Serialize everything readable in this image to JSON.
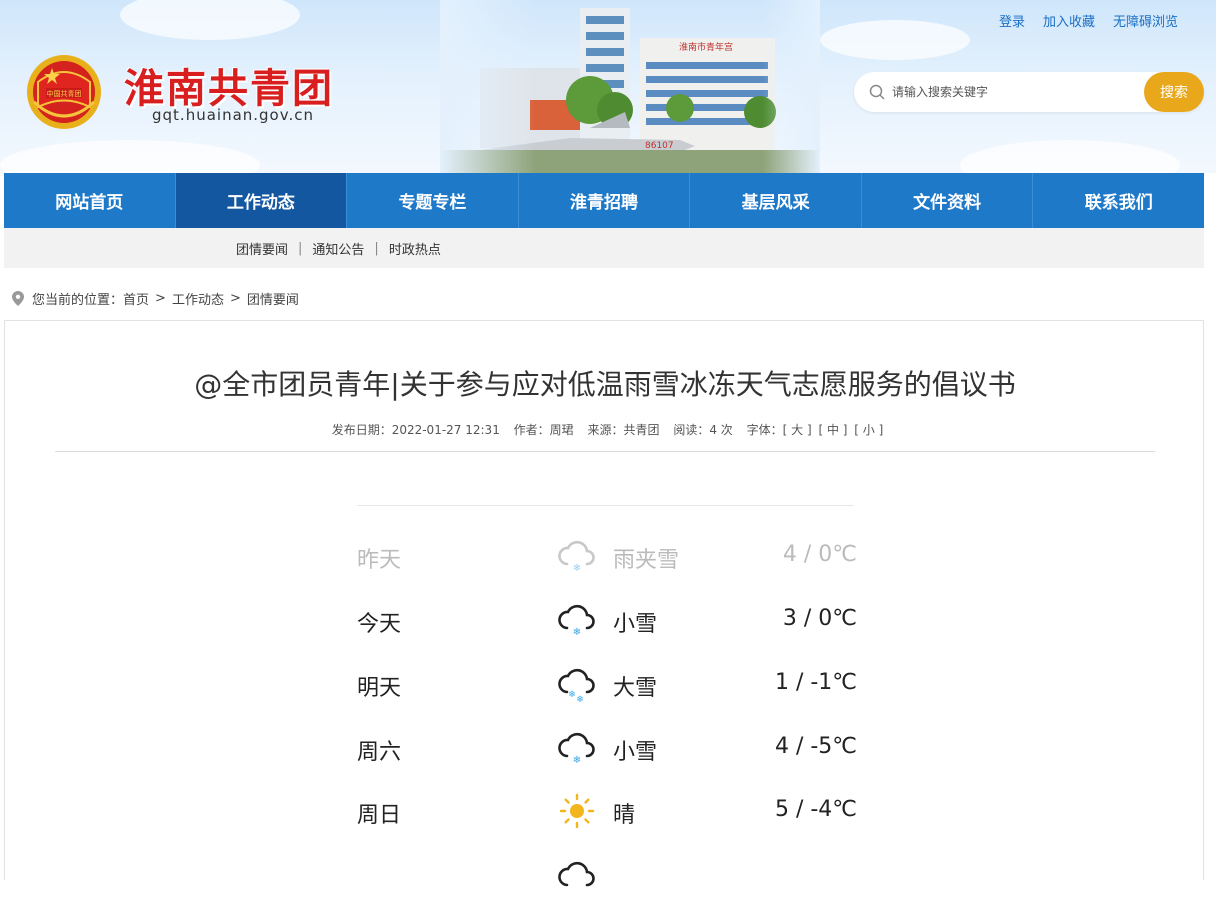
{
  "header": {
    "site_title": "淮南共青团",
    "site_domain": "gqt.huainan.gov.cn",
    "top_links": [
      "登录",
      "加入收藏",
      "无障碍浏览"
    ],
    "search_placeholder": "请输入搜索关键字",
    "search_button": "搜索",
    "building_sign": "淮南市青年宫",
    "plane_number": "86107"
  },
  "nav": {
    "items": [
      "网站首页",
      "工作动态",
      "专题专栏",
      "淮青招聘",
      "基层风采",
      "文件资料",
      "联系我们"
    ],
    "active": "工作动态"
  },
  "subnav": {
    "items": [
      "团情要闻",
      "通知公告",
      "时政热点"
    ],
    "separator": "|"
  },
  "breadcrumb": {
    "prefix": "您当前的位置：",
    "items": [
      "首页",
      "工作动态",
      "团情要闻"
    ],
    "separator": ">"
  },
  "article": {
    "title": "@全市团员青年|关于参与应对低温雨雪冰冻天气志愿服务的倡议书",
    "meta": {
      "date": "发布日期：2022-01-27 12:31",
      "author": "作者：周珺",
      "source": "来源：共青团",
      "reads": "阅读：4 次",
      "font_label": "字体：",
      "font_large": "[ 大 ]",
      "font_medium": "[ 中 ]",
      "font_small": "[ 小 ]"
    },
    "weather": [
      {
        "day": "昨天",
        "icon": "sleet-icon",
        "condition": "雨夹雪",
        "temp": "4 / 0℃",
        "faded": true
      },
      {
        "day": "今天",
        "icon": "light-snow-icon",
        "condition": "小雪",
        "temp": "3 / 0℃",
        "faded": false
      },
      {
        "day": "明天",
        "icon": "heavy-snow-icon",
        "condition": "大雪",
        "temp": "1 / -1℃",
        "faded": false
      },
      {
        "day": "周六",
        "icon": "light-snow-icon",
        "condition": "小雪",
        "temp": "4 / -5℃",
        "faded": false
      },
      {
        "day": "周日",
        "icon": "sunny-icon",
        "condition": "晴",
        "temp": "5 / -4℃",
        "faded": false
      }
    ]
  },
  "colors": {
    "nav_blue": "#1f79c9",
    "nav_active": "#1457a1",
    "title_red": "#d81e1e",
    "search_orange": "#e9a81c",
    "link_blue": "#1a6fc4",
    "snow_blue": "#3aa7e6",
    "sun_yellow": "#f2b51c"
  }
}
